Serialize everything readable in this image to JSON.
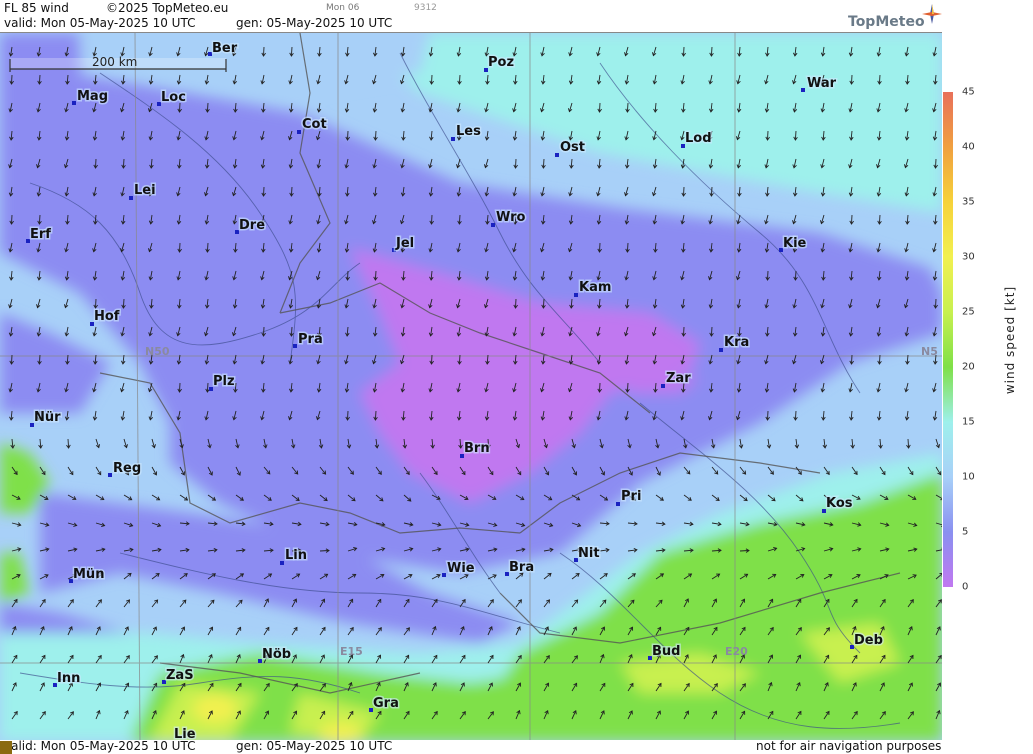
{
  "header": {
    "product": "FL 85 wind",
    "copyright": "©2025 TopMeteo.eu",
    "day": "Mon 06",
    "code": "9312",
    "valid": "valid:  Mon  05-May-2025  10 UTC",
    "gen": "gen: 05-May-2025 10 UTC"
  },
  "footer": {
    "valid": "valid:  Mon  05-May-2025  10 UTC",
    "gen": "gen: 05-May-2025 10 UTC",
    "disclaimer": "not for air navigation purposes"
  },
  "logo": {
    "text": "TopMeteo"
  },
  "scale_bar": {
    "label": "200 km"
  },
  "grid_labels": [
    "N50",
    "N5",
    "E15",
    "E20"
  ],
  "colorbar": {
    "title": "wind speed [kt]",
    "ticks": [
      "45",
      "40",
      "35",
      "30",
      "25",
      "20",
      "15",
      "10",
      "5",
      "0"
    ],
    "colors": [
      "#e8705a",
      "#f0a040",
      "#f6d23a",
      "#f2f050",
      "#c8f050",
      "#7fe048",
      "#9ef0ec",
      "#a8d0f8",
      "#8a90f0",
      "#c078f0"
    ]
  },
  "cities": [
    "Ber",
    "Poz",
    "War",
    "Mag",
    "Loc",
    "Cot",
    "Les",
    "Ost",
    "Lod",
    "Lei",
    "Erf",
    "Dre",
    "Jel",
    "Wro",
    "Kie",
    "Kam",
    "Hof",
    "Pra",
    "Kra",
    "Plz",
    "Zar",
    "Nür",
    "Brn",
    "Reg",
    "Pri",
    "Kos",
    "Lin",
    "Nit",
    "Mün",
    "Wie",
    "Bra",
    "Nöb",
    "Bud",
    "Deb",
    "Inn",
    "ZaS",
    "Gra",
    "Lie"
  ]
}
